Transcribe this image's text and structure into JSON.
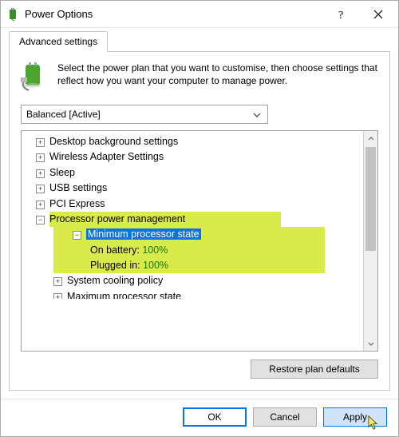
{
  "title": "Power Options",
  "tab_label": "Advanced settings",
  "intro_text": "Select the power plan that you want to customise, then choose settings that reflect how you want your computer to manage power.",
  "plan_selected": "Balanced [Active]",
  "tree": {
    "desktop_bg": "Desktop background settings",
    "wireless": "Wireless Adapter Settings",
    "sleep": "Sleep",
    "usb": "USB settings",
    "pci": "PCI Express",
    "proc_mgmt": "Processor power management",
    "min_state": "Minimum processor state",
    "on_battery_label": "On battery:",
    "on_battery_value": "100%",
    "plugged_in_label": "Plugged in:",
    "plugged_in_value": "100%",
    "cooling": "System cooling policy",
    "max_state": "Maximum processor state"
  },
  "buttons": {
    "restore": "Restore plan defaults",
    "ok": "OK",
    "cancel": "Cancel",
    "apply": "Apply"
  }
}
